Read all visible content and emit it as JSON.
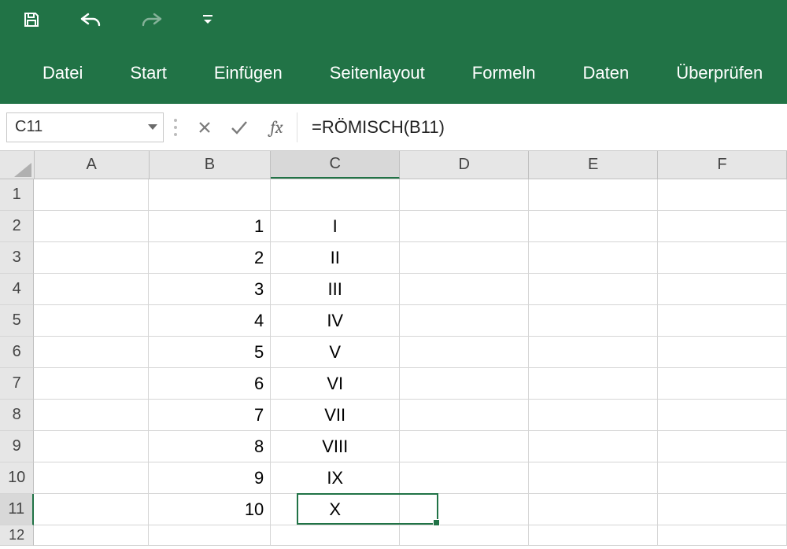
{
  "qat": {
    "save_icon": "save-icon",
    "undo_icon": "undo-icon",
    "redo_icon": "redo-icon",
    "customize_icon": "customize-qat-icon"
  },
  "tabs": [
    "Datei",
    "Start",
    "Einfügen",
    "Seitenlayout",
    "Formeln",
    "Daten",
    "Überprüfen"
  ],
  "namebox": {
    "value": "C11"
  },
  "fx": {
    "cancel_icon": "cancel-icon",
    "enter_icon": "enter-icon",
    "fx_label": "fx",
    "formula": "=RÖMISCH(B11)"
  },
  "columns": [
    "A",
    "B",
    "C",
    "D",
    "E",
    "F"
  ],
  "selected_column": "C",
  "row_headers": [
    "1",
    "2",
    "3",
    "4",
    "5",
    "6",
    "7",
    "8",
    "9",
    "10",
    "11",
    "12"
  ],
  "selected_row": "11",
  "cells": {
    "B2": "1",
    "B3": "2",
    "B4": "3",
    "B5": "4",
    "B6": "5",
    "B7": "6",
    "B8": "7",
    "B9": "8",
    "B10": "9",
    "B11": "10",
    "C2": "I",
    "C3": "II",
    "C4": "III",
    "C5": "IV",
    "C6": "V",
    "C7": "VI",
    "C8": "VII",
    "C9": "VIII",
    "C10": "IX",
    "C11": "X"
  },
  "active_cell": "C11",
  "colors": {
    "accent": "#217346"
  }
}
